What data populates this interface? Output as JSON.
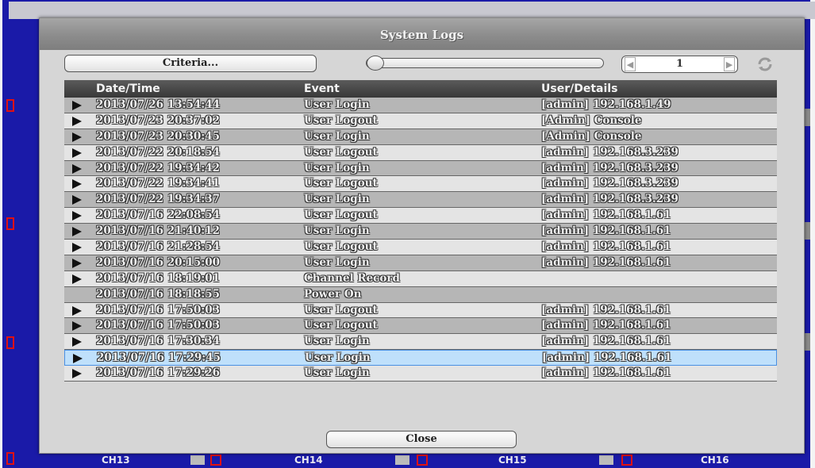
{
  "dialog": {
    "title": "System Logs",
    "criteria_label": "Criteria...",
    "page": "1",
    "close_label": "Close",
    "slider_level": 0
  },
  "table": {
    "headers": [
      "Date/Time",
      "Event",
      "User/Details"
    ],
    "rows": [
      {
        "arrow": true,
        "date": "2013/07/26 13:54:44",
        "event": "User Login",
        "user": "[admin] 192.168.1.49"
      },
      {
        "arrow": true,
        "date": "2013/07/23 20:37:02",
        "event": "User Logout",
        "user": "[Admin] Console"
      },
      {
        "arrow": true,
        "date": "2013/07/23 20:30:45",
        "event": "User Login",
        "user": "[Admin] Console"
      },
      {
        "arrow": true,
        "date": "2013/07/22 20:18:54",
        "event": "User Logout",
        "user": "[admin] 192.168.3.239"
      },
      {
        "arrow": true,
        "date": "2013/07/22 19:34:42",
        "event": "User Login",
        "user": "[admin] 192.168.3.239"
      },
      {
        "arrow": true,
        "date": "2013/07/22 19:34:41",
        "event": "User Logout",
        "user": "[admin] 192.168.3.239"
      },
      {
        "arrow": true,
        "date": "2013/07/22 19:34:37",
        "event": "User Login",
        "user": "[admin] 192.168.3.239"
      },
      {
        "arrow": true,
        "date": "2013/07/16 22:08:54",
        "event": "User Logout",
        "user": "[admin] 192.168.1.61"
      },
      {
        "arrow": true,
        "date": "2013/07/16 21:40:12",
        "event": "User Login",
        "user": "[admin] 192.168.1.61"
      },
      {
        "arrow": true,
        "date": "2013/07/16 21:28:54",
        "event": "User Logout",
        "user": "[admin] 192.168.1.61"
      },
      {
        "arrow": true,
        "date": "2013/07/16 20:15:00",
        "event": "User Login",
        "user": "[admin] 192.168.1.61"
      },
      {
        "arrow": true,
        "date": "2013/07/16 18:19:01",
        "event": "Channel Record",
        "user": ""
      },
      {
        "arrow": false,
        "date": "2013/07/16 18:18:55",
        "event": "Power On",
        "user": ""
      },
      {
        "arrow": true,
        "date": "2013/07/16 17:50:03",
        "event": "User Logout",
        "user": "[admin] 192.168.1.61"
      },
      {
        "arrow": true,
        "date": "2013/07/16 17:50:03",
        "event": "User Logout",
        "user": "[admin] 192.168.1.61"
      },
      {
        "arrow": true,
        "date": "2013/07/16 17:30:34",
        "event": "User Login",
        "user": "[admin] 192.168.1.61"
      },
      {
        "arrow": true,
        "date": "2013/07/16 17:29:45",
        "event": "User Login",
        "user": "[admin] 192.168.1.61",
        "selected": true
      },
      {
        "arrow": true,
        "date": "2013/07/16 17:29:26",
        "event": "User Login",
        "user": "[admin] 192.168.1.61"
      }
    ]
  },
  "background": {
    "channels": [
      "CH13",
      "CH14",
      "CH15",
      "CH16"
    ],
    "accent_red": "#e01010",
    "screen_blue": "#1a1aa8"
  },
  "colors": {
    "header_bg": "#444444",
    "row_dark": "#b6b6b6",
    "row_light": "#e4e4e4",
    "row_selected": "#bfe0fb"
  }
}
